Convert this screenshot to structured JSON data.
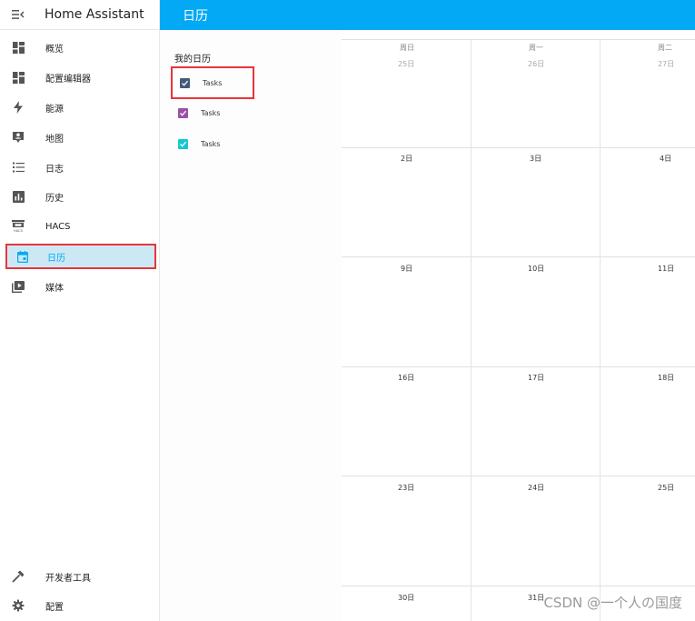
{
  "app": {
    "title": "Home Assistant"
  },
  "sidebar": {
    "items": [
      {
        "label": "概览",
        "icon": "dashboard-icon"
      },
      {
        "label": "配置编辑器",
        "icon": "dashboard-icon"
      },
      {
        "label": "能源",
        "icon": "lightning-icon"
      },
      {
        "label": "地图",
        "icon": "map-person-icon"
      },
      {
        "label": "日志",
        "icon": "list-icon"
      },
      {
        "label": "历史",
        "icon": "chart-icon"
      },
      {
        "label": "HACS",
        "icon": "hacs-icon"
      },
      {
        "label": "日历",
        "icon": "calendar-icon",
        "active": true
      },
      {
        "label": "媒体",
        "icon": "media-icon"
      }
    ],
    "bottom": [
      {
        "label": "开发者工具",
        "icon": "hammer-icon"
      },
      {
        "label": "配置",
        "icon": "gear-icon"
      }
    ]
  },
  "header": {
    "title": "日历"
  },
  "calendars": {
    "heading": "我的日历",
    "items": [
      {
        "label": "Tasks",
        "color": "#455a7a",
        "checked": true
      },
      {
        "label": "Tasks",
        "color": "#9c4fa8",
        "checked": true
      },
      {
        "label": "Tasks",
        "color": "#18c7d0",
        "checked": true
      }
    ]
  },
  "month": {
    "weekdays": [
      "周日",
      "周一",
      "周二"
    ],
    "rows": [
      [
        "25日",
        "26日",
        "27日"
      ],
      [
        "2日",
        "3日",
        "4日"
      ],
      [
        "9日",
        "10日",
        "11日"
      ],
      [
        "16日",
        "17日",
        "18日"
      ],
      [
        "23日",
        "24日",
        "25日"
      ],
      [
        "30日",
        "31日",
        ""
      ]
    ]
  },
  "accent_colors": {
    "primary": "#03a9f4",
    "highlight_box": "#e8343b"
  },
  "watermark": "CSDN @一个人の国度"
}
